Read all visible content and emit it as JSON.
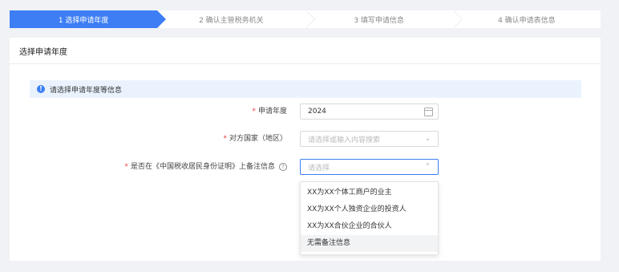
{
  "steps": [
    {
      "label": "1  选择申请年度",
      "active": true
    },
    {
      "label": "2  确认主管税务机关",
      "active": false
    },
    {
      "label": "3  填写申请信息",
      "active": false
    },
    {
      "label": "4  确认申请表信息",
      "active": false
    }
  ],
  "card": {
    "title": "选择申请年度",
    "info": "请选择申请年度等信息"
  },
  "form": {
    "year": {
      "required": "*",
      "label": "申请年度",
      "value": "2024"
    },
    "country": {
      "required": "*",
      "label": "对方国家（地区）",
      "placeholder": "请选择或输入内容搜索"
    },
    "remark": {
      "required": "*",
      "label": "是否在《中国税收居民身份证明》上备注信息",
      "placeholder": "请选择"
    }
  },
  "dropdown": {
    "options": [
      "XX为XX个体工商户的业主",
      "XX为XX个人独资企业的投资人",
      "XX为XX合伙企业的合伙人",
      "无需备注信息"
    ],
    "hovered_index": 3
  },
  "colors": {
    "accent": "#3d7ef5",
    "required": "#f04040",
    "info_bg": "#eaf3fd"
  },
  "icons": {
    "info": "info-circle-icon",
    "help": "question-circle-icon",
    "calendar": "calendar-icon",
    "chevron_down": "chevron-down-icon",
    "chevron_up": "chevron-up-icon"
  }
}
